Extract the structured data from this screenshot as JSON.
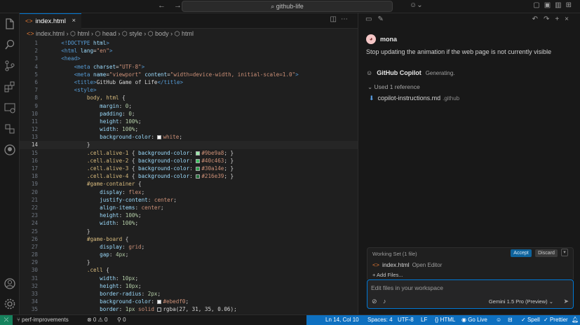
{
  "titlebar": {
    "search_text": "github-life"
  },
  "editor": {
    "tab_title": "index.html",
    "breadcrumbs": [
      "index.html",
      "html",
      "head",
      "style",
      "body",
      "html"
    ],
    "lines": [
      {
        "n": "1",
        "segs": [
          [
            "t",
            "    "
          ],
          [
            "tag",
            "<!DOCTYPE "
          ],
          [
            "attr",
            "html"
          ],
          [
            "tag",
            ">"
          ]
        ]
      },
      {
        "n": "2",
        "segs": [
          [
            "t",
            "    "
          ],
          [
            "tag",
            "<html "
          ],
          [
            "attr",
            "lang"
          ],
          [
            "t",
            "="
          ],
          [
            "str",
            "\"en\""
          ],
          [
            "tag",
            ">"
          ]
        ]
      },
      {
        "n": "3",
        "segs": [
          [
            "t",
            "    "
          ],
          [
            "tag",
            "<head>"
          ]
        ]
      },
      {
        "n": "4",
        "segs": [
          [
            "t",
            "        "
          ],
          [
            "tag",
            "<meta "
          ],
          [
            "attr",
            "charset"
          ],
          [
            "t",
            "="
          ],
          [
            "str",
            "\"UTF-8\""
          ],
          [
            "tag",
            ">"
          ]
        ]
      },
      {
        "n": "5",
        "segs": [
          [
            "t",
            "        "
          ],
          [
            "tag",
            "<meta "
          ],
          [
            "attr",
            "name"
          ],
          [
            "t",
            "="
          ],
          [
            "str",
            "\"viewport\""
          ],
          [
            "t",
            " "
          ],
          [
            "attr",
            "content"
          ],
          [
            "t",
            "="
          ],
          [
            "str",
            "\"width=device-width, initial-scale=1.0\""
          ],
          [
            "tag",
            ">"
          ]
        ]
      },
      {
        "n": "6",
        "segs": [
          [
            "t",
            "        "
          ],
          [
            "tag",
            "<title>"
          ],
          [
            "t",
            "GitHub Game of Life"
          ],
          [
            "tag",
            "</title>"
          ]
        ]
      },
      {
        "n": "7",
        "segs": [
          [
            "t",
            "        "
          ],
          [
            "tag",
            "<style>"
          ]
        ]
      },
      {
        "n": "8",
        "segs": [
          [
            "t",
            "            "
          ],
          [
            "sel",
            "body, html"
          ],
          [
            "t",
            " {"
          ]
        ]
      },
      {
        "n": "9",
        "segs": [
          [
            "t",
            "                "
          ],
          [
            "prop",
            "margin"
          ],
          [
            "t",
            ": "
          ],
          [
            "num",
            "0"
          ],
          [
            "t",
            ";"
          ]
        ]
      },
      {
        "n": "10",
        "segs": [
          [
            "t",
            "                "
          ],
          [
            "prop",
            "padding"
          ],
          [
            "t",
            ": "
          ],
          [
            "num",
            "0"
          ],
          [
            "t",
            ";"
          ]
        ]
      },
      {
        "n": "11",
        "segs": [
          [
            "t",
            "                "
          ],
          [
            "prop",
            "height"
          ],
          [
            "t",
            ": "
          ],
          [
            "num",
            "100%"
          ],
          [
            "t",
            ";"
          ]
        ]
      },
      {
        "n": "12",
        "segs": [
          [
            "t",
            "                "
          ],
          [
            "prop",
            "width"
          ],
          [
            "t",
            ": "
          ],
          [
            "num",
            "100%"
          ],
          [
            "t",
            ";"
          ]
        ]
      },
      {
        "n": "13",
        "segs": [
          [
            "t",
            "                "
          ],
          [
            "prop",
            "background-color"
          ],
          [
            "t",
            ": "
          ],
          [
            "sw",
            "#ffffff"
          ],
          [
            "val",
            "white"
          ],
          [
            "t",
            ";"
          ]
        ]
      },
      {
        "n": "14",
        "cur": true,
        "segs": [
          [
            "t",
            "            }"
          ]
        ]
      },
      {
        "n": "15",
        "segs": [
          [
            "t",
            "            "
          ],
          [
            "sel",
            ".cell.alive-1"
          ],
          [
            "t",
            " { "
          ],
          [
            "prop",
            "background-color"
          ],
          [
            "t",
            ": "
          ],
          [
            "sw",
            "#9be9a8"
          ],
          [
            "val",
            "#9be9a8"
          ],
          [
            "t",
            "; }"
          ]
        ]
      },
      {
        "n": "16",
        "segs": [
          [
            "t",
            "            "
          ],
          [
            "sel",
            ".cell.alive-2"
          ],
          [
            "t",
            " { "
          ],
          [
            "prop",
            "background-color"
          ],
          [
            "t",
            ": "
          ],
          [
            "sw",
            "#40c463"
          ],
          [
            "val",
            "#40c463"
          ],
          [
            "t",
            "; }"
          ]
        ]
      },
      {
        "n": "17",
        "segs": [
          [
            "t",
            "            "
          ],
          [
            "sel",
            ".cell.alive-3"
          ],
          [
            "t",
            " { "
          ],
          [
            "prop",
            "background-color"
          ],
          [
            "t",
            ": "
          ],
          [
            "sw",
            "#30a14e"
          ],
          [
            "val",
            "#30a14e"
          ],
          [
            "t",
            "; }"
          ]
        ]
      },
      {
        "n": "18",
        "segs": [
          [
            "t",
            "            "
          ],
          [
            "sel",
            ".cell.alive-4"
          ],
          [
            "t",
            " { "
          ],
          [
            "prop",
            "background-color"
          ],
          [
            "t",
            ": "
          ],
          [
            "sw",
            "#216e39"
          ],
          [
            "val",
            "#216e39"
          ],
          [
            "t",
            "; }"
          ]
        ]
      },
      {
        "n": "19",
        "segs": [
          [
            "t",
            "            "
          ],
          [
            "sel",
            "#game-container"
          ],
          [
            "t",
            " {"
          ]
        ]
      },
      {
        "n": "20",
        "segs": [
          [
            "t",
            "                "
          ],
          [
            "prop",
            "display"
          ],
          [
            "t",
            ": "
          ],
          [
            "val",
            "flex"
          ],
          [
            "t",
            ";"
          ]
        ]
      },
      {
        "n": "21",
        "segs": [
          [
            "t",
            "                "
          ],
          [
            "prop",
            "justify-content"
          ],
          [
            "t",
            ": "
          ],
          [
            "val",
            "center"
          ],
          [
            "t",
            ";"
          ]
        ]
      },
      {
        "n": "22",
        "segs": [
          [
            "t",
            "                "
          ],
          [
            "prop",
            "align-items"
          ],
          [
            "t",
            ": "
          ],
          [
            "val",
            "center"
          ],
          [
            "t",
            ";"
          ]
        ]
      },
      {
        "n": "23",
        "segs": [
          [
            "t",
            "                "
          ],
          [
            "prop",
            "height"
          ],
          [
            "t",
            ": "
          ],
          [
            "num",
            "100%"
          ],
          [
            "t",
            ";"
          ]
        ]
      },
      {
        "n": "24",
        "segs": [
          [
            "t",
            "                "
          ],
          [
            "prop",
            "width"
          ],
          [
            "t",
            ": "
          ],
          [
            "num",
            "100%"
          ],
          [
            "t",
            ";"
          ]
        ]
      },
      {
        "n": "25",
        "segs": [
          [
            "t",
            "            }"
          ]
        ]
      },
      {
        "n": "26",
        "segs": [
          [
            "t",
            "            "
          ],
          [
            "sel",
            "#game-board"
          ],
          [
            "t",
            " {"
          ]
        ]
      },
      {
        "n": "27",
        "segs": [
          [
            "t",
            "                "
          ],
          [
            "prop",
            "display"
          ],
          [
            "t",
            ": "
          ],
          [
            "val",
            "grid"
          ],
          [
            "t",
            ";"
          ]
        ]
      },
      {
        "n": "28",
        "segs": [
          [
            "t",
            "                "
          ],
          [
            "prop",
            "gap"
          ],
          [
            "t",
            ": "
          ],
          [
            "num",
            "4px"
          ],
          [
            "t",
            ";"
          ]
        ]
      },
      {
        "n": "29",
        "segs": [
          [
            "t",
            "            }"
          ]
        ]
      },
      {
        "n": "30",
        "segs": [
          [
            "t",
            "            "
          ],
          [
            "sel",
            ".cell"
          ],
          [
            "t",
            " {"
          ]
        ]
      },
      {
        "n": "31",
        "segs": [
          [
            "t",
            "                "
          ],
          [
            "prop",
            "width"
          ],
          [
            "t",
            ": "
          ],
          [
            "num",
            "10px"
          ],
          [
            "t",
            ";"
          ]
        ]
      },
      {
        "n": "32",
        "segs": [
          [
            "t",
            "                "
          ],
          [
            "prop",
            "height"
          ],
          [
            "t",
            ": "
          ],
          [
            "num",
            "10px"
          ],
          [
            "t",
            ";"
          ]
        ]
      },
      {
        "n": "33",
        "segs": [
          [
            "t",
            "                "
          ],
          [
            "prop",
            "border-radius"
          ],
          [
            "t",
            ": "
          ],
          [
            "num",
            "2px"
          ],
          [
            "t",
            ";"
          ]
        ]
      },
      {
        "n": "34",
        "segs": [
          [
            "t",
            "                "
          ],
          [
            "prop",
            "background-color"
          ],
          [
            "t",
            ": "
          ],
          [
            "sw",
            "#ebedf0"
          ],
          [
            "val",
            "#ebedf0"
          ],
          [
            "t",
            ";"
          ]
        ]
      },
      {
        "n": "35",
        "segs": [
          [
            "t",
            "                "
          ],
          [
            "prop",
            "border"
          ],
          [
            "t",
            ": "
          ],
          [
            "num",
            "1px"
          ],
          [
            "t",
            " "
          ],
          [
            "val",
            "solid"
          ],
          [
            "t",
            " "
          ],
          [
            "sw",
            "#1b1f23"
          ],
          [
            "t",
            "rgba(27, 31, 35, 0.06);"
          ]
        ]
      }
    ]
  },
  "chat": {
    "user_name": "mona",
    "user_message": "Stop updating the animation if the web page is not currently visible",
    "assistant_name": "GitHub Copilot",
    "assistant_status": "Generating.",
    "references_label": "Used 1 reference",
    "reference_file": "copilot-instructions.md",
    "reference_dir": ".github",
    "working_set_title": "Working Set (1 file)",
    "accept_label": "Accept",
    "discard_label": "Discard",
    "working_file": "index.html",
    "working_file_state": "Open Editor",
    "add_files_label": "+ Add Files...",
    "input_placeholder": "Edit files in your workspace",
    "model_label": "Gemini 1.5 Pro (Preview)"
  },
  "statusbar": {
    "branch": "perf-improvements",
    "problems": "⊗ 0 ⚠ 0",
    "ports": "0",
    "position": "Ln 14, Col 10",
    "spaces": "Spaces: 4",
    "encoding": "UTF-8",
    "eol": "LF",
    "language": "HTML",
    "golive": "Go Live",
    "spell": "Spell",
    "prettier": "Prettier"
  },
  "colors": {
    "accent": "#0078d4",
    "statusbar_blue": "#0e70c0",
    "remote_green": "#16825d"
  }
}
